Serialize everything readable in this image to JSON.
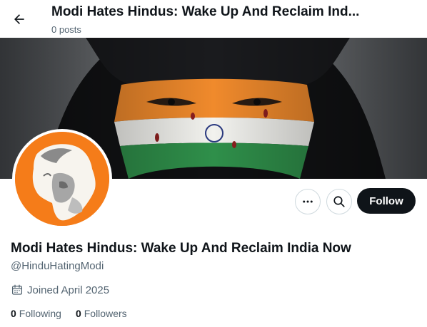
{
  "header": {
    "title": "Modi Hates Hindus: Wake Up And Reclaim Ind...",
    "posts": "0 posts",
    "back_icon": "arrow-left-icon"
  },
  "profile": {
    "display_name": "Modi Hates Hindus: Wake Up And Reclaim India Now",
    "handle": "@HinduHatingModi",
    "joined": "Joined April 2025",
    "following_count": "0",
    "following_label": "Following",
    "followers_count": "0",
    "followers_label": "Followers"
  },
  "actions": {
    "more_icon": "more-horizontal-icon",
    "search_icon": "search-icon",
    "follow_label": "Follow"
  },
  "colors": {
    "avatar_bg": "#f57c19",
    "follow_button_bg": "#0f1419",
    "secondary_text": "#536471",
    "saffron": "#f08a2c",
    "indian_green": "#2f8f4a"
  }
}
